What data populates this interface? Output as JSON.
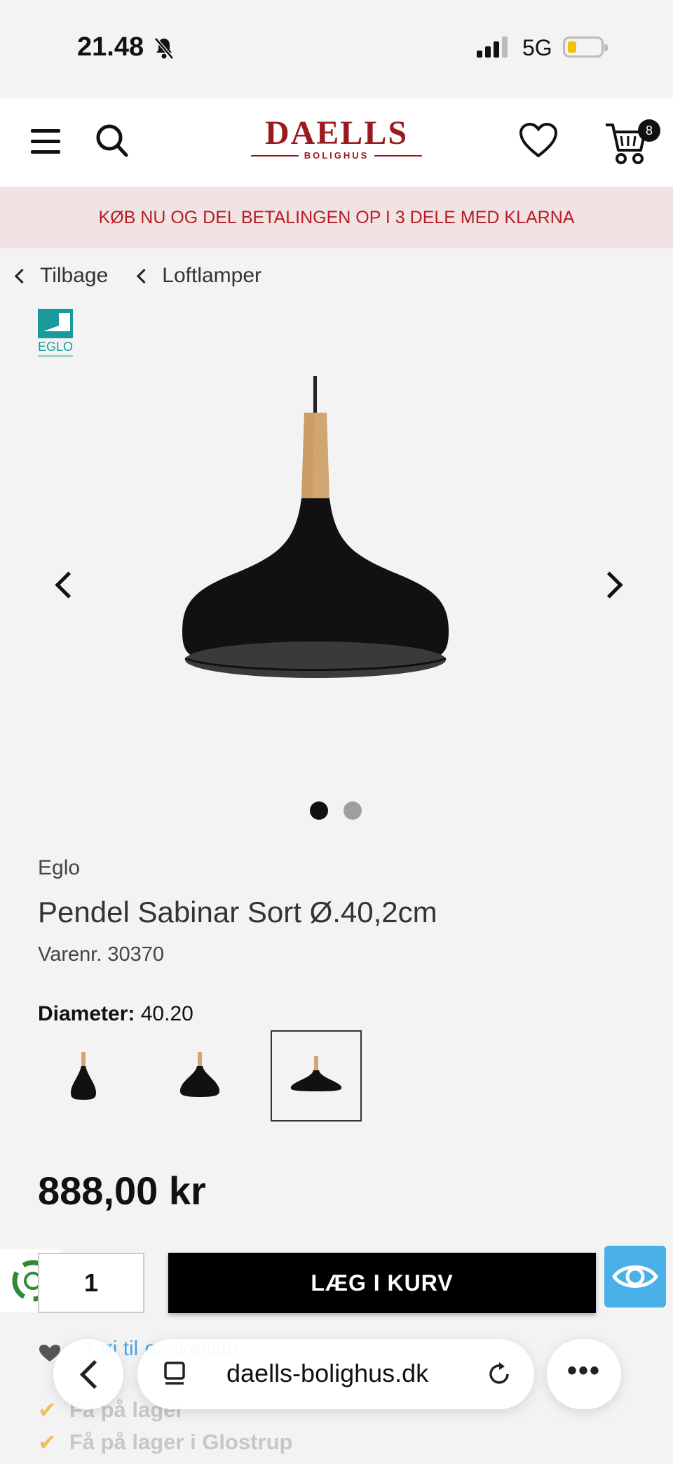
{
  "status_bar": {
    "time": "21.48",
    "network": "5G"
  },
  "header": {
    "logo_text": "DAELLS",
    "logo_sub": "BOLIGHUS",
    "cart_count": "8"
  },
  "banner": {
    "text": "KØB NU OG DEL BETALINGEN OP I 3 DELE MED KLARNA"
  },
  "breadcrumbs": [
    {
      "label": "Tilbage"
    },
    {
      "label": "Loftlamper"
    }
  ],
  "product": {
    "brand_logo_text": "EGLO",
    "brand": "Eglo",
    "title": "Pendel Sabinar Sort Ø.40,2cm",
    "sku_label": "Varenr.",
    "sku": "30370",
    "option_label": "Diameter:",
    "option_value": "40.20",
    "price": "888,00 kr",
    "quantity": "1",
    "add_to_cart_label": "LÆG I KURV",
    "gallery_total": 2,
    "gallery_active": 1
  },
  "lower": {
    "link_text": "Føj til ønskeliste",
    "stock_1": "Få på lager",
    "stock_2": "Få på lager i Glostrup"
  },
  "browser": {
    "url": "daells-bolighus.dk",
    "more": "•••"
  },
  "colors": {
    "brand_red": "#9a1b1f",
    "banner_bg": "#f1e3e3",
    "banner_text": "#b81c24",
    "accent_blue": "#4ab0e8"
  }
}
